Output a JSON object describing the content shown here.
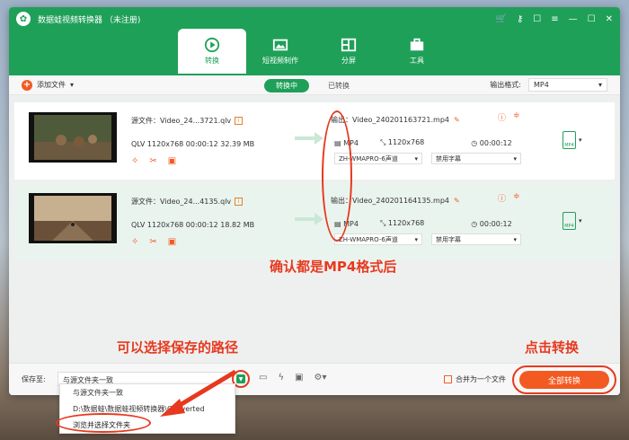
{
  "app": {
    "title": "数据蛙视频转换器 （未注册)"
  },
  "tabs": [
    {
      "label": "转换",
      "icon": "convert-icon"
    },
    {
      "label": "短视频制作",
      "icon": "image-icon"
    },
    {
      "label": "分屏",
      "icon": "split-screen-icon"
    },
    {
      "label": "工具",
      "icon": "toolbox-icon"
    }
  ],
  "toolbar": {
    "add_file": "添加文件",
    "status_tabs": [
      "转换中",
      "已转换"
    ],
    "output_format_label": "输出格式:",
    "output_format_value": "MP4"
  },
  "items": [
    {
      "source": "源文件：Video_24...3721.qlv",
      "meta": "QLV   1120x768   00:00:12   32.39 MB",
      "output": "输出：Video_240201163721.mp4",
      "format": "MP4",
      "resolution": "1120x768",
      "duration": "00:00:12",
      "audio": "ZH-WMAPRO-6声道",
      "subtitle": "禁用字幕"
    },
    {
      "source": "源文件：Video_24...4135.qlv",
      "meta": "QLV   1120x768   00:00:12   18.82 MB",
      "output": "输出：Video_240201164135.mp4",
      "format": "MP4",
      "resolution": "1120x768",
      "duration": "00:00:12",
      "audio": "ZH-WMAPRO-6声道",
      "subtitle": "禁用字幕"
    }
  ],
  "annotations": {
    "confirm_mp4": "确认都是MP4格式后",
    "save_path": "可以选择保存的路径",
    "click_convert": "点击转换"
  },
  "bottom": {
    "save_to_label": "保存至:",
    "save_to_value": "与源文件夹一致",
    "merge_label": "合并为一个文件",
    "convert_all": "全部转换"
  },
  "save_menu": [
    "与源文件夹一致",
    "D:\\数据蛙\\数据蛙视频转换器\\Converted",
    "浏览并选择文件夹"
  ],
  "colors": {
    "brand": "#1fa058",
    "accent": "#f25a22",
    "annotation": "#e63a1f"
  }
}
